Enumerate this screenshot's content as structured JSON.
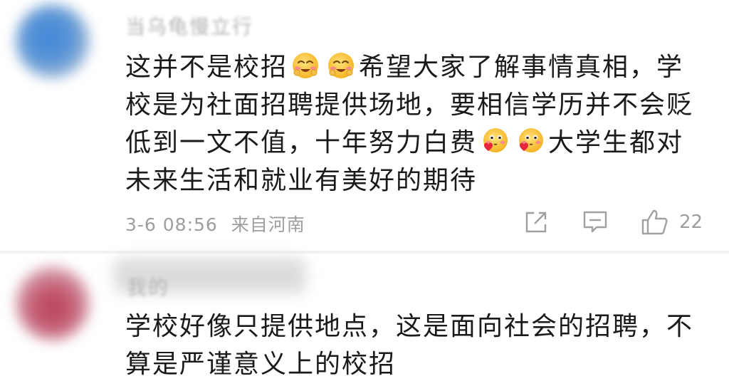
{
  "comments": [
    {
      "username": "当乌龟慢立行",
      "body_lines": [
        [
          "这并不是校招",
          "[emoji:happy]",
          "[emoji:happy]",
          "希望大家了解事情真相，学"
        ],
        [
          "校是为社面招聘提供场地，要相信学历并不会贬"
        ],
        [
          "低到一文不值，十年努力白费",
          "[emoji:heart]",
          "[emoji:heart]",
          "大学生都对"
        ],
        [
          "未来生活和就业有美好的期待"
        ]
      ],
      "text": {
        "l1a": "这并不是校招",
        "l1b": "希望大家了解事情真相，学",
        "l2": "校是为社面招聘提供场地，要相信学历并不会贬",
        "l3a": "低到一文不值，十年努力白费",
        "l3b": "大学生都对",
        "l4": "未来生活和就业有美好的期待"
      },
      "date": "3-6 08:56",
      "location": "来自河南",
      "like_count": "22",
      "icons": [
        "share-icon",
        "reply-icon",
        "like-icon"
      ]
    },
    {
      "username": "我的",
      "text": {
        "l1": "学校好像只提供地点，这是面向社会的招聘，不",
        "l2": "算是严谨意义上的校招"
      }
    }
  ],
  "emoji_names": {
    "happy": "smile-blush-emoji",
    "heart": "heart-kiss-emoji"
  }
}
